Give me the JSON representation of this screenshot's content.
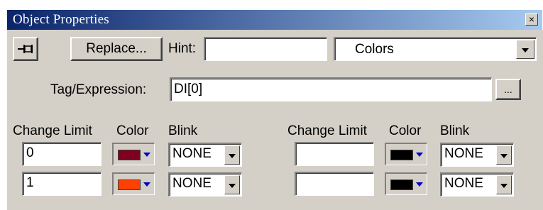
{
  "window": {
    "title": "Object Properties",
    "close_glyph": "×"
  },
  "toolbar": {
    "pin_icon": "pin-icon",
    "replace_label": "Replace...",
    "hint_label": "Hint:",
    "hint_value": "",
    "category_value": "Colors"
  },
  "tag": {
    "label": "Tag/Expression:",
    "value": "DI[0]",
    "browse_label": "..."
  },
  "headers": {
    "change_limit": "Change Limit",
    "color": "Color",
    "blink": "Blink"
  },
  "left_rows": [
    {
      "limit": "0",
      "color": "#800020",
      "blink": "NONE"
    },
    {
      "limit": "1",
      "color": "#ff4000",
      "blink": "NONE"
    }
  ],
  "right_rows": [
    {
      "limit": "",
      "color": "#000000",
      "blink": "NONE"
    },
    {
      "limit": "",
      "color": "#000000",
      "blink": "NONE"
    }
  ]
}
